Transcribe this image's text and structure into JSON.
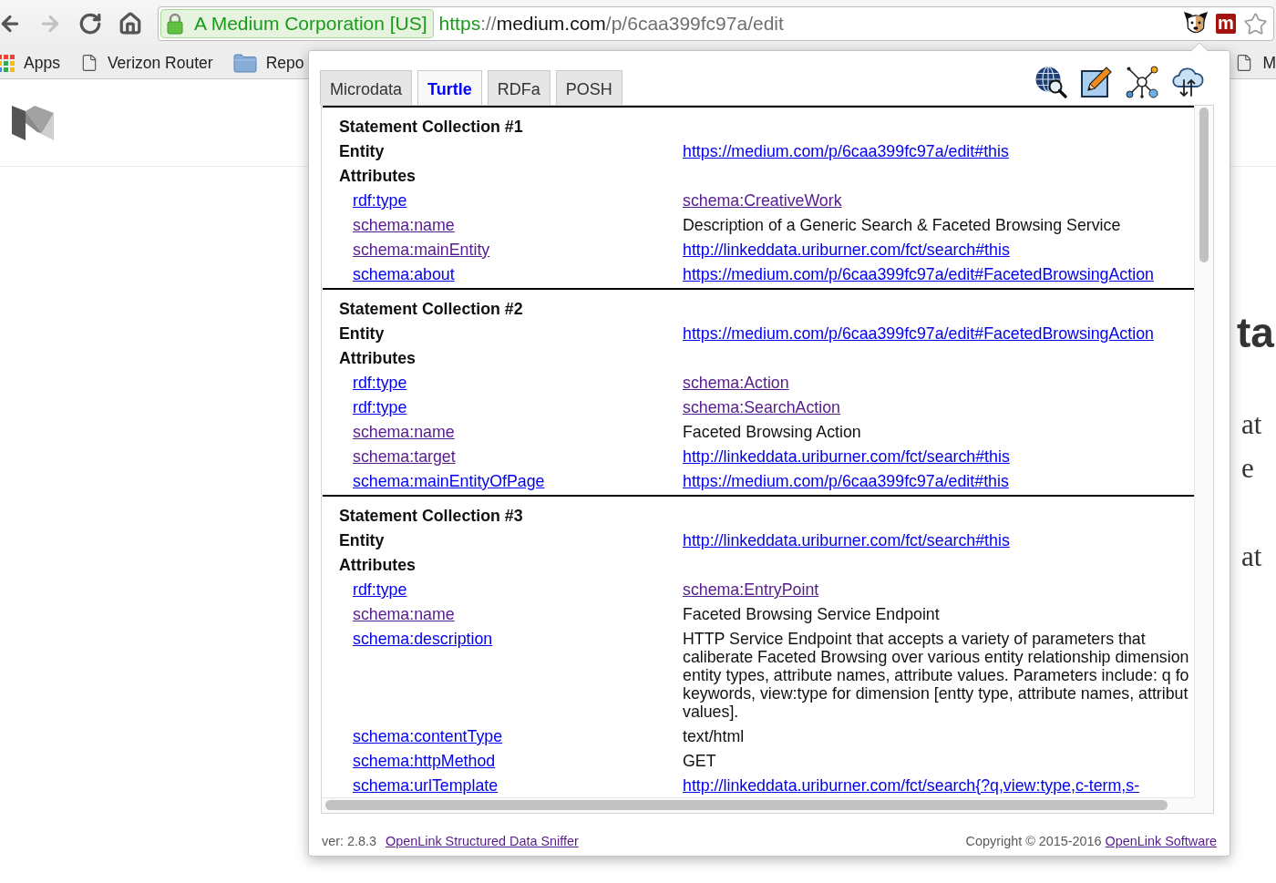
{
  "browser": {
    "nav": [
      {
        "kind": "back",
        "disabled": false
      },
      {
        "kind": "forward",
        "disabled": true
      },
      {
        "kind": "reload",
        "disabled": false
      },
      {
        "kind": "home",
        "disabled": false
      }
    ],
    "security_chip": "A Medium Corporation [US]",
    "url": {
      "scheme": "https",
      "separator": "://",
      "host": "medium.com",
      "path": "/p/6caa399fc97a/edit"
    },
    "extensions": [
      {
        "kind": "dog"
      },
      {
        "kind": "letter",
        "label": "m"
      }
    ]
  },
  "bookmarks": {
    "start": [
      {
        "kind": "apps",
        "label": "Apps"
      },
      {
        "kind": "page",
        "label": "Verizon Router"
      },
      {
        "kind": "folder",
        "label": "Repo"
      }
    ],
    "end": [
      {
        "kind": "page",
        "label": "M"
      }
    ]
  },
  "page": {
    "headline": "ta",
    "paragraphs": [
      [
        "at",
        "e"
      ],
      [
        "at"
      ]
    ]
  },
  "sniffer": {
    "tabs": [
      {
        "label": "Microdata",
        "selected": false
      },
      {
        "label": "Turtle",
        "selected": true
      },
      {
        "label": "RDFa",
        "selected": false
      },
      {
        "label": "POSH",
        "selected": false
      }
    ],
    "tools": [
      {
        "kind": "globe-search"
      },
      {
        "kind": "edit"
      },
      {
        "kind": "network"
      },
      {
        "kind": "cloud"
      }
    ],
    "collections": [
      {
        "title": "Statement Collection #1",
        "entity_label": "Entity",
        "entity": {
          "text": "https://medium.com/p/6caa399fc97a/edit#this",
          "visited": false
        },
        "attributes_label": "Attributes",
        "attributes": [
          {
            "name": {
              "text": "rdf:type",
              "visited": false
            },
            "value": {
              "kind": "link",
              "text": "schema:CreativeWork",
              "visited": true
            }
          },
          {
            "name": {
              "text": "schema:name",
              "visited": true
            },
            "value": {
              "kind": "text",
              "text": "Description of a Generic Search & Faceted Browsing Service"
            }
          },
          {
            "name": {
              "text": "schema:mainEntity",
              "visited": true
            },
            "value": {
              "kind": "link",
              "text": "http://linkeddata.uriburner.com/fct/search#this",
              "visited": false
            }
          },
          {
            "name": {
              "text": "schema:about",
              "visited": false
            },
            "value": {
              "kind": "link",
              "text": "https://medium.com/p/6caa399fc97a/edit#FacetedBrowsingAction",
              "visited": false
            }
          }
        ]
      },
      {
        "title": "Statement Collection #2",
        "entity_label": "Entity",
        "entity": {
          "text": "https://medium.com/p/6caa399fc97a/edit#FacetedBrowsingAction",
          "visited": false
        },
        "attributes_label": "Attributes",
        "attributes": [
          {
            "name": {
              "text": "rdf:type",
              "visited": false
            },
            "value": {
              "kind": "link",
              "text": "schema:Action",
              "visited": true
            }
          },
          {
            "name": {
              "text": "rdf:type",
              "visited": false
            },
            "value": {
              "kind": "link",
              "text": "schema:SearchAction",
              "visited": true
            }
          },
          {
            "name": {
              "text": "schema:name",
              "visited": true
            },
            "value": {
              "kind": "text",
              "text": "Faceted Browsing Action"
            }
          },
          {
            "name": {
              "text": "schema:target",
              "visited": true
            },
            "value": {
              "kind": "link",
              "text": "http://linkeddata.uriburner.com/fct/search#this",
              "visited": false
            }
          },
          {
            "name": {
              "text": "schema:mainEntityOfPage",
              "visited": false
            },
            "value": {
              "kind": "link",
              "text": "https://medium.com/p/6caa399fc97a/edit#this",
              "visited": false
            }
          }
        ]
      },
      {
        "title": "Statement Collection #3",
        "entity_label": "Entity",
        "entity": {
          "text": "http://linkeddata.uriburner.com/fct/search#this",
          "visited": false
        },
        "attributes_label": "Attributes",
        "attributes": [
          {
            "name": {
              "text": "rdf:type",
              "visited": false
            },
            "value": {
              "kind": "link",
              "text": "schema:EntryPoint",
              "visited": true
            }
          },
          {
            "name": {
              "text": "schema:name",
              "visited": true
            },
            "value": {
              "kind": "text",
              "text": "Faceted Browsing Service Endpoint"
            }
          },
          {
            "name": {
              "text": "schema:description",
              "visited": false
            },
            "value": {
              "kind": "paragraph",
              "lines": [
                "HTTP Service Endpoint that accepts a variety of parameters that",
                "caliberate Faceted Browsing over various entity relationship dimension",
                "entity types, attribute names, attribute values. Parameters include: q fo",
                "keywords, view:type for dimension [entty type, attribute names, attribut",
                "values]."
              ]
            }
          },
          {
            "name": {
              "text": "schema:contentType",
              "visited": false
            },
            "value": {
              "kind": "text",
              "text": "text/html"
            }
          },
          {
            "name": {
              "text": "schema:httpMethod",
              "visited": false
            },
            "value": {
              "kind": "text",
              "text": "GET"
            }
          },
          {
            "name": {
              "text": "schema:urlTemplate",
              "visited": false
            },
            "value": {
              "kind": "link",
              "text": "http://linkeddata.uriburner.com/fct/search{?q,view:type,c-term,s-",
              "visited": false
            }
          }
        ]
      }
    ],
    "footer": {
      "version": "ver: 2.8.3",
      "app_link": {
        "text": "OpenLink Structured Data Sniffer",
        "visited": true
      },
      "copyright": "Copyright © 2015-2016",
      "vendor_link": {
        "text": "OpenLink Software",
        "visited": true
      }
    }
  }
}
